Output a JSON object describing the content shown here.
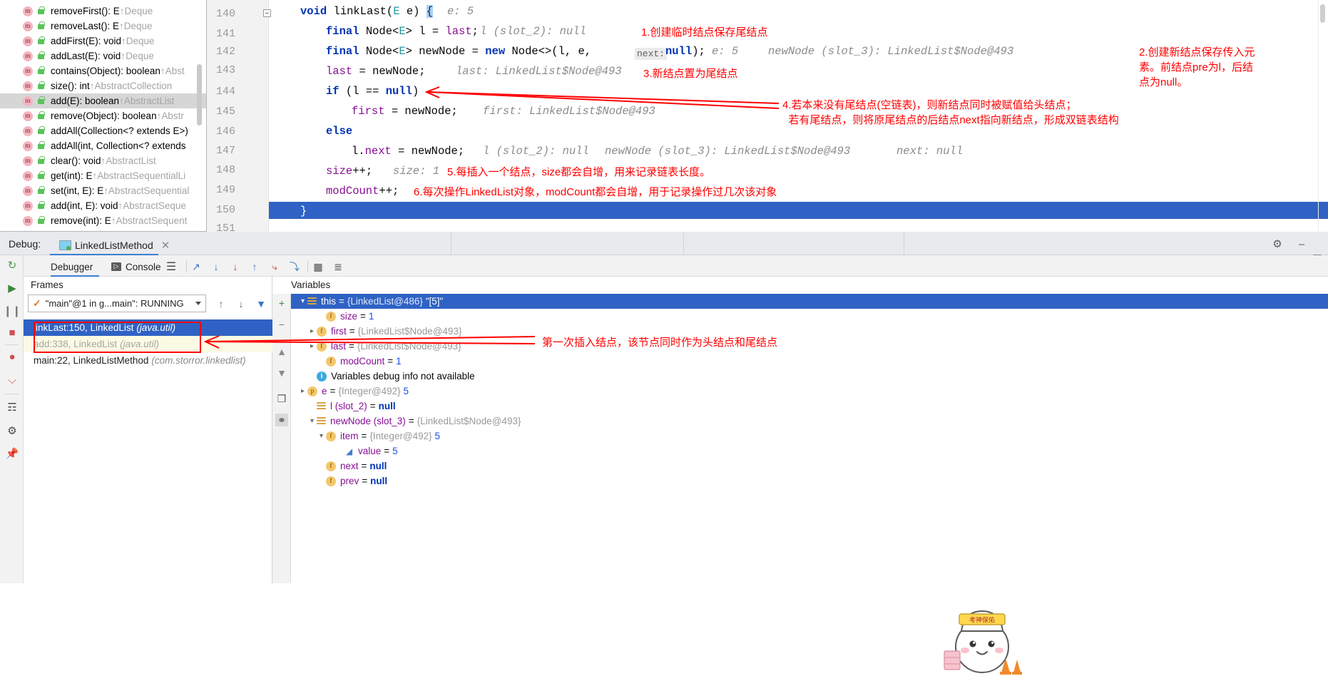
{
  "completion_popup": {
    "items": [
      {
        "name": "removeFirst(): E ",
        "tail": "↑Deque"
      },
      {
        "name": "removeLast(): E ",
        "tail": "↑Deque"
      },
      {
        "name": "addFirst(E): void ",
        "tail": "↑Deque"
      },
      {
        "name": "addLast(E): void ",
        "tail": "↑Deque"
      },
      {
        "name": "contains(Object): boolean ",
        "tail": "↑Abst"
      },
      {
        "name": "size(): int ",
        "tail": "↑AbstractCollection"
      },
      {
        "name": "add(E): boolean ",
        "tail": "↑AbstractList"
      },
      {
        "name": "remove(Object): boolean ",
        "tail": "↑Abstr"
      },
      {
        "name": "addAll(Collection<? extends E>)",
        "tail": ""
      },
      {
        "name": "addAll(int, Collection<? extends",
        "tail": ""
      },
      {
        "name": "clear(): void ",
        "tail": "↑AbstractList"
      },
      {
        "name": "get(int): E ",
        "tail": "↑AbstractSequentialLi"
      },
      {
        "name": "set(int, E): E ",
        "tail": "↑AbstractSequential"
      },
      {
        "name": "add(int, E): void ",
        "tail": "↑AbstractSeque"
      },
      {
        "name": "remove(int): E ",
        "tail": "↑AbstractSequent"
      }
    ],
    "selected_index": 6,
    "member_icon": "m",
    "visibility_icon": "public-lock-icon"
  },
  "editor": {
    "line_numbers": [
      "140",
      "141",
      "142",
      "143",
      "144",
      "145",
      "146",
      "147",
      "148",
      "149",
      "150",
      "151"
    ],
    "current_line": "150",
    "lines": {
      "l140": {
        "code": "void linkLast(E e) {",
        "hint": "e: 5"
      },
      "l141": {
        "code": "final Node<E> l = last;",
        "hint": "l (slot_2): null"
      },
      "l142": {
        "code": "final Node<E> newNode = new Node<>(l, e,",
        "param_hint": "next:",
        "code2": "null);",
        "hint": "e: 5",
        "hint2": "newNode (slot_3): LinkedList$Node@493"
      },
      "l143": {
        "code": "last = newNode;",
        "hint": "last: LinkedList$Node@493"
      },
      "l144": {
        "code": "if (l == null)"
      },
      "l145": {
        "code": "first = newNode;",
        "hint": "first: LinkedList$Node@493"
      },
      "l146": {
        "code": "else"
      },
      "l147": {
        "code": "l.next = newNode;",
        "hint": "l (slot_2): null",
        "hint2": "newNode (slot_3): LinkedList$Node@493",
        "hint3": "next: null"
      },
      "l148": {
        "code": "size++;",
        "hint": "size: 1"
      },
      "l149": {
        "code": "modCount++;"
      },
      "l150": {
        "code": "}"
      }
    },
    "annotations": [
      {
        "id": "a1",
        "text": "1.创建临时结点保存尾结点"
      },
      {
        "id": "a2",
        "text": "2.创建新结点保存传入元\n素。前结点pre为l，后结\n点为null。"
      },
      {
        "id": "a3",
        "text": "3.新结点置为尾结点"
      },
      {
        "id": "a4",
        "text": "4.若本来没有尾结点(空链表)，则新结点同时被赋值给头结点；\n  若有尾结点，则将原尾结点的后结点next指向新结点，形成双链表结构"
      },
      {
        "id": "a5",
        "text": "5.每插入一个结点，size都会自增，用来记录链表长度。"
      },
      {
        "id": "a6",
        "text": "6.每次操作LinkedList对象，modCount都会自增，用于记录操作过几次该对象"
      }
    ]
  },
  "debug_header": {
    "label": "Debug:",
    "tab_title": "LinkedListMethod",
    "close_icon": "close-icon",
    "settings_icon": "gear-icon",
    "minimize_icon": "minimize-icon",
    "layout_icon": "layout-icon"
  },
  "debug_tabs": {
    "debugger": "Debugger",
    "console": "Console",
    "console_icon": "console-icon",
    "layout_icon": "layout-settings-icon",
    "toolbar_icons": [
      "step-over-icon",
      "step-into-icon",
      "force-step-into-icon",
      "step-out-icon",
      "drop-frame-icon",
      "run-to-cursor-icon",
      "evaluate-expression-icon",
      "settings-icon"
    ]
  },
  "run_strip": {
    "icons": [
      "rerun-icon",
      "resume-program-icon",
      "pause-program-icon",
      "stop-icon",
      "view-breakpoints-icon",
      "mute-breakpoints-icon",
      "screenshot-icon",
      "settings-icon",
      "pin-icon"
    ]
  },
  "frames": {
    "label": "Frames",
    "thread": "\"main\"@1 in g...main\": RUNNING",
    "status_icon": "check-icon",
    "dropdown_icon": "chevron-down-icon",
    "up_icon": "arrow-up-icon",
    "down_icon": "arrow-down-icon",
    "filter_icon": "filter-icon",
    "rows": [
      {
        "text": "linkLast:150, LinkedList ",
        "pkg": "(java.util)",
        "state": "selected"
      },
      {
        "text": "add:338, LinkedList ",
        "pkg": "(java.util)",
        "state": "library"
      },
      {
        "text": "main:22, LinkedListMethod ",
        "pkg": "(com.storror.linkedlist)",
        "state": "normal"
      }
    ]
  },
  "variables": {
    "label": "Variables",
    "toolbar_icons": [
      "add-watch-icon",
      "remove-watch-icon",
      "move-up-icon",
      "move-down-icon",
      "copy-icon",
      "inspect-icon"
    ],
    "rows": [
      {
        "indent": 0,
        "arrow": "open",
        "icon": "object-icon",
        "name": "this",
        "eq": "=",
        "ref": "{LinkedList@486}",
        "value": "\"[5]\"",
        "vtype": "str",
        "state": "selected"
      },
      {
        "indent": 1,
        "arrow": "none",
        "icon": "field-icon",
        "name": "size",
        "eq": "=",
        "ref": "",
        "value": "1",
        "vtype": "num",
        "state": "normal"
      },
      {
        "indent": 1,
        "arrow": "closed",
        "icon": "field-icon",
        "name": "first",
        "eq": "=",
        "ref": "{LinkedList$Node@493}",
        "value": "",
        "vtype": "plain",
        "state": "normal"
      },
      {
        "indent": 1,
        "arrow": "closed",
        "icon": "field-icon",
        "name": "last",
        "eq": "=",
        "ref": "{LinkedList$Node@493}",
        "value": "",
        "vtype": "plain",
        "state": "normal"
      },
      {
        "indent": 1,
        "arrow": "none",
        "icon": "field-icon",
        "name": "modCount",
        "eq": "=",
        "ref": "",
        "value": "1",
        "vtype": "num",
        "state": "normal"
      },
      {
        "indent": 0,
        "arrow": "none",
        "icon": "info-icon",
        "name": "Variables debug info not available",
        "eq": "",
        "ref": "",
        "value": "",
        "vtype": "plain",
        "state": "info"
      },
      {
        "indent": 0,
        "arrow": "closed",
        "icon": "param-icon",
        "name": "e",
        "eq": "=",
        "ref": "{Integer@492}",
        "value": "5",
        "vtype": "num",
        "state": "normal"
      },
      {
        "indent": 0,
        "arrow": "none",
        "icon": "object-icon",
        "name": "l (slot_2)",
        "eq": "=",
        "ref": "",
        "value": "null",
        "vtype": "null",
        "state": "normal"
      },
      {
        "indent": 0,
        "arrow": "open",
        "icon": "object-icon",
        "name": "newNode (slot_3)",
        "eq": "=",
        "ref": "{LinkedList$Node@493}",
        "value": "",
        "vtype": "plain",
        "state": "normal"
      },
      {
        "indent": 1,
        "arrow": "open",
        "icon": "field-icon",
        "name": "item",
        "eq": "=",
        "ref": "{Integer@492}",
        "value": "5",
        "vtype": "num",
        "state": "normal"
      },
      {
        "indent": 2,
        "arrow": "none",
        "icon": "value-icon",
        "name": "value",
        "eq": "=",
        "ref": "",
        "value": "5",
        "vtype": "num",
        "state": "normal"
      },
      {
        "indent": 1,
        "arrow": "none",
        "icon": "field-icon",
        "name": "next",
        "eq": "=",
        "ref": "",
        "value": "null",
        "vtype": "null",
        "state": "normal"
      },
      {
        "indent": 1,
        "arrow": "none",
        "icon": "field-icon",
        "name": "prev",
        "eq": "=",
        "ref": "",
        "value": "null",
        "vtype": "null",
        "state": "normal"
      }
    ],
    "annotation": "第一次插入结点，该节点同时作为头结点和尾结点"
  },
  "colors": {
    "selection_blue": "#2f62c4",
    "annotation_red": "#ff0000",
    "keyword_blue": "#0033b3",
    "field_purple": "#871094",
    "hint_gray": "#8c8c8c",
    "library_frame_yellow": "#fbfae4"
  }
}
